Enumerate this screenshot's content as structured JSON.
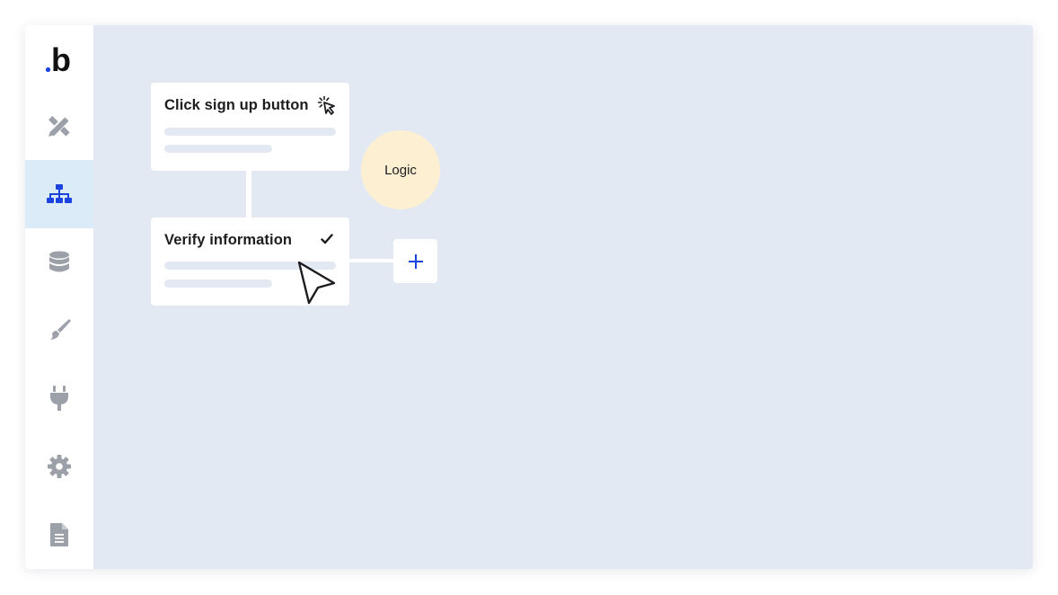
{
  "colors": {
    "brand_blue": "#1B43E0",
    "sidebar_icon_gray": "#9CA0A8",
    "active_bg": "#DCEBF8",
    "canvas_bg": "#E3E9F2",
    "logic_bg": "#FDF0D2"
  },
  "logo": {
    "letter": "b"
  },
  "sidebar": {
    "items": [
      {
        "icon": "design-tools-icon",
        "active": false
      },
      {
        "icon": "workflow-hierarchy-icon",
        "active": true
      },
      {
        "icon": "database-icon",
        "active": false
      },
      {
        "icon": "paintbrush-icon",
        "active": false
      },
      {
        "icon": "plug-icon",
        "active": false
      },
      {
        "icon": "gear-icon",
        "active": false
      },
      {
        "icon": "document-icon",
        "active": false
      }
    ]
  },
  "workflow": {
    "step1": {
      "title": "Click sign up button",
      "icon": "click-cursor-icon"
    },
    "step2": {
      "title": "Verify information",
      "icon": "checkmark-icon"
    },
    "logic": {
      "label": "Logic"
    },
    "add": {
      "symbol": "+"
    }
  }
}
